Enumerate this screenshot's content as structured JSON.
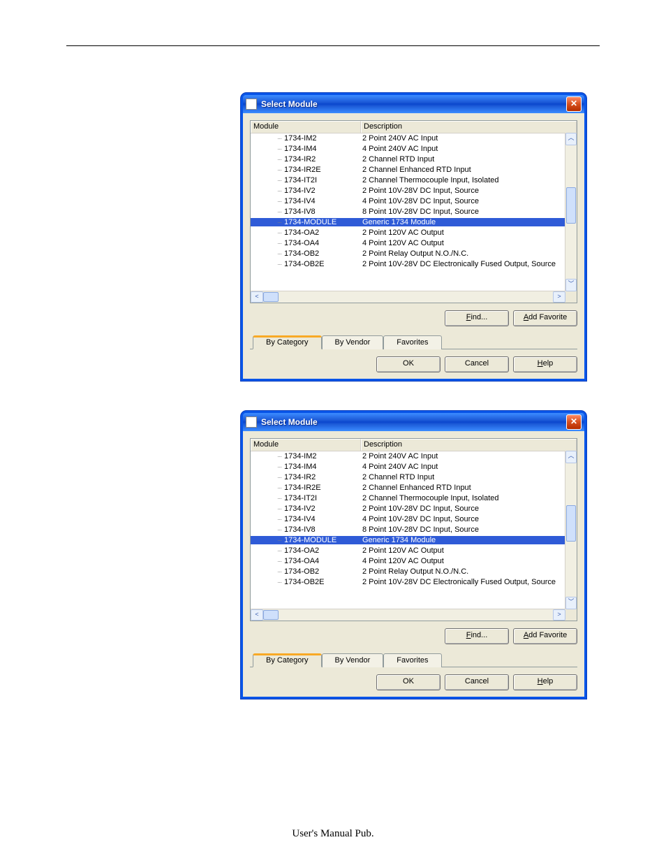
{
  "page": {
    "footer": "User's Manual Pub."
  },
  "dialog": {
    "title": "Select Module",
    "headers": {
      "module": "Module",
      "description": "Description"
    },
    "rows": [
      {
        "module": "1734-IM2",
        "description": "2 Point 240V AC Input"
      },
      {
        "module": "1734-IM4",
        "description": "4 Point 240V AC Input"
      },
      {
        "module": "1734-IR2",
        "description": "2 Channel RTD Input"
      },
      {
        "module": "1734-IR2E",
        "description": "2 Channel Enhanced RTD Input"
      },
      {
        "module": "1734-IT2I",
        "description": "2 Channel Thermocouple Input, Isolated"
      },
      {
        "module": "1734-IV2",
        "description": "2 Point 10V-28V DC Input, Source"
      },
      {
        "module": "1734-IV4",
        "description": "4 Point 10V-28V DC Input, Source"
      },
      {
        "module": "1734-IV8",
        "description": "8 Point 10V-28V DC Input, Source"
      },
      {
        "module": "1734-MODULE",
        "description": "Generic 1734 Module",
        "selected": true
      },
      {
        "module": "1734-OA2",
        "description": "2 Point 120V AC Output"
      },
      {
        "module": "1734-OA4",
        "description": "4 Point 120V AC Output"
      },
      {
        "module": "1734-OB2",
        "description": "2 Point Relay Output N.O./N.C."
      },
      {
        "module": "1734-OB2E",
        "description": "2 Point 10V-28V DC Electronically Fused Output, Source"
      }
    ],
    "buttons": {
      "find": "Find...",
      "add_favorite": "Add Favorite",
      "ok": "OK",
      "cancel": "Cancel",
      "help": "Help"
    },
    "tabs": {
      "by_category": "By Category",
      "by_vendor": "By Vendor",
      "favorites": "Favorites"
    }
  }
}
